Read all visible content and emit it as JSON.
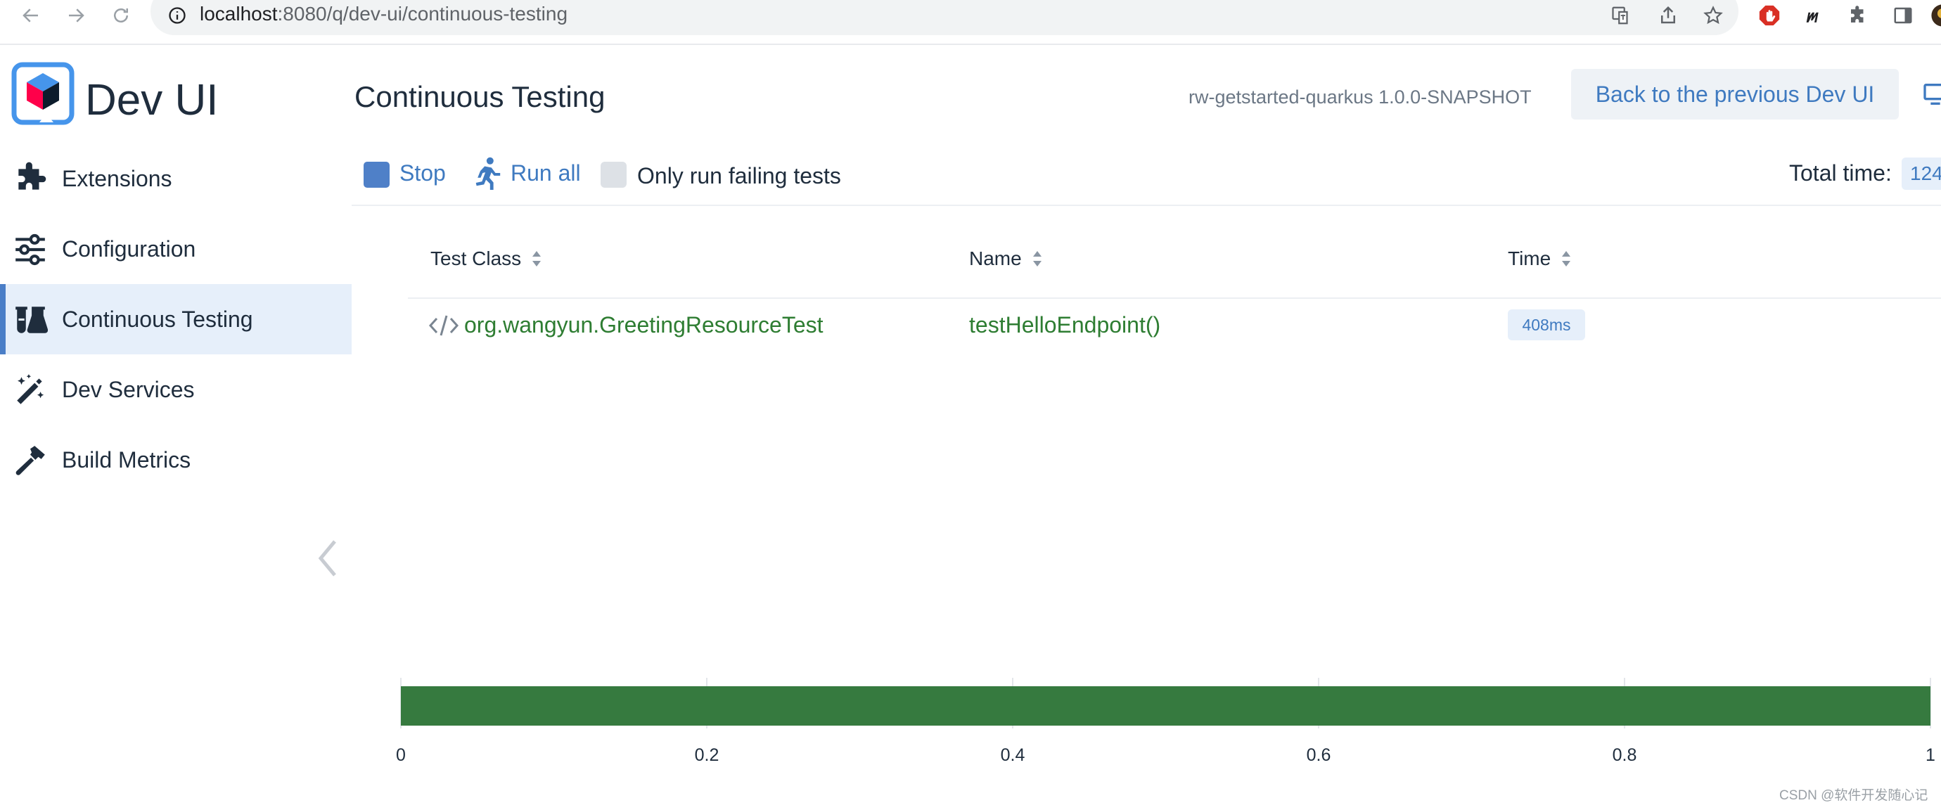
{
  "browser": {
    "url_host": "localhost",
    "url_rest": ":8080/q/dev-ui/continuous-testing",
    "icons": [
      "back-arrow-icon",
      "forward-arrow-icon",
      "reload-icon",
      "site-info-icon",
      "translate-icon",
      "share-icon",
      "bookmark-star-icon",
      "adblock-icon",
      "extension-m-icon",
      "extensions-puzzle-icon",
      "side-panel-icon",
      "profile-avatar-icon"
    ]
  },
  "sidebar": {
    "brand": "Dev UI",
    "items": [
      {
        "label": "Extensions",
        "icon": "puzzle-icon",
        "active": false
      },
      {
        "label": "Configuration",
        "icon": "sliders-icon",
        "active": false
      },
      {
        "label": "Continuous Testing",
        "icon": "flask-icon",
        "active": true
      },
      {
        "label": "Dev Services",
        "icon": "magic-wand-icon",
        "active": false
      },
      {
        "label": "Build Metrics",
        "icon": "hammer-icon",
        "active": false
      }
    ]
  },
  "header": {
    "title": "Continuous Testing",
    "project": "rw-getstarted-quarkus 1.0.0-SNAPSHOT",
    "back_button": "Back to the previous Dev UI"
  },
  "toolbar": {
    "stop": "Stop",
    "run_all": "Run all",
    "only_failing": "Only run failing tests",
    "only_failing_checked": false,
    "total_time_label": "Total time:",
    "total_time_value": "124"
  },
  "table": {
    "columns": [
      "Test Class",
      "Name",
      "Time"
    ],
    "rows": [
      {
        "test_class": "org.wangyun.GreetingResourceTest",
        "name": "testHelloEndpoint()",
        "time": "408ms"
      }
    ]
  },
  "chart_data": {
    "type": "bar",
    "orientation": "horizontal",
    "values": [
      1
    ],
    "xlim": [
      0,
      1
    ],
    "ticks": [
      "0",
      "0.2",
      "0.4",
      "0.6",
      "0.8",
      "1"
    ],
    "grid": true,
    "color": "#367a3f"
  },
  "colors": {
    "accent": "#3f7ac0",
    "pass_green": "#2e7d32",
    "active_bg": "#e6effa"
  },
  "watermark": "CSDN @软件开发随心记"
}
